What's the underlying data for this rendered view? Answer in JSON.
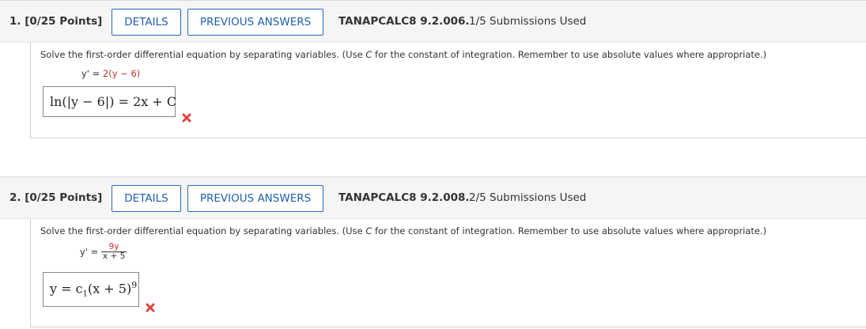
{
  "instruction_prefix": "Solve the first-order differential equation by separating variables. (Use ",
  "instruction_var": "C",
  "instruction_suffix": " for the constant of integration. Remember to use absolute values where appropriate.)",
  "questions": [
    {
      "number": "1.",
      "points": "[0/25 Points]",
      "details_label": "DETAILS",
      "previous_label": "PREVIOUS ANSWERS",
      "code": "TANAPCALC8 9.2.006.",
      "submissions": "1/5 Submissions Used",
      "equation_lhs": "y' = ",
      "equation_rhs": "2(y − 6)",
      "answer": "ln(|y − 6|) = 2x + C",
      "answer_status": "incorrect"
    },
    {
      "number": "2.",
      "points": "[0/25 Points]",
      "details_label": "DETAILS",
      "previous_label": "PREVIOUS ANSWERS",
      "code": "TANAPCALC8 9.2.008.",
      "submissions": "2/5 Submissions Used",
      "equation_lhs": "y' = ",
      "equation_numerator": "9y",
      "equation_denominator": "x + 5",
      "answer_base": "y = c",
      "answer_sub": "1",
      "answer_paren": "(x + 5)",
      "answer_exp": "9",
      "answer_status": "incorrect"
    }
  ],
  "colors": {
    "accent": "#1f5fae",
    "incorrect": "#e0443e",
    "header_bg": "#f5f5f5"
  },
  "icons": {
    "status": "cross-icon"
  }
}
